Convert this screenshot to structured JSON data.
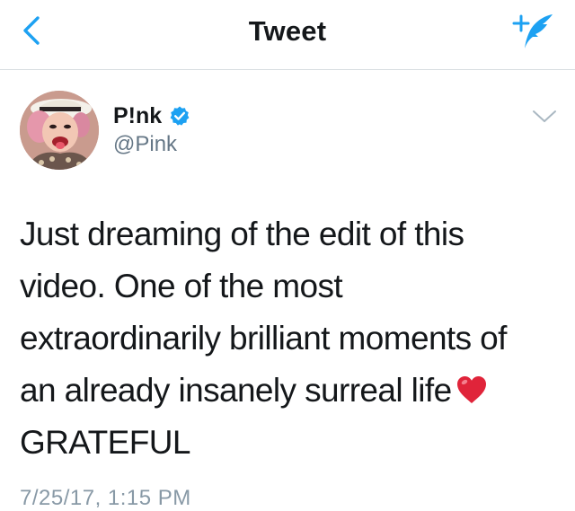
{
  "header": {
    "title": "Tweet",
    "back_icon": "chevron-left-icon",
    "compose_icon": "compose-tweet-icon"
  },
  "author": {
    "name": "P!nk",
    "handle": "@Pink",
    "verified": true,
    "menu_icon": "chevron-down-icon"
  },
  "tweet": {
    "lines": [
      "Just dreaming of the edit of this",
      "video. One of the most",
      "extraordinarily brilliant moments of",
      "an already insanely surreal life",
      "GRATEFUL"
    ],
    "emoji": "red-heart-icon",
    "timestamp": "7/25/17, 1:15 PM"
  },
  "colors": {
    "accent": "#1da1f2",
    "text": "#14171a",
    "secondary_text": "#657786",
    "divider": "#d8dde1",
    "heart": "#e0243a"
  }
}
